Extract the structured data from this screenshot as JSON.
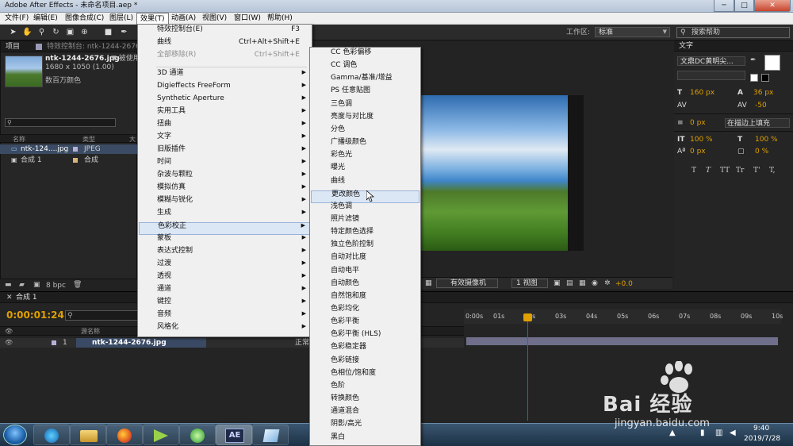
{
  "window": {
    "title": "Adobe After Effects - 未命名项目.aep *",
    "btn_min": "─",
    "btn_max": "□",
    "btn_close": "✕"
  },
  "menubar": [
    "文件(F)",
    "编辑(E)",
    "图像合成(C)",
    "图层(L)",
    "效果(T)",
    "动画(A)",
    "视图(V)",
    "窗口(W)",
    "帮助(H)"
  ],
  "toolbar": {
    "workspace_label": "工作区:",
    "workspace_value": "标准",
    "search_placeholder": "搜索帮助"
  },
  "project": {
    "tab": "项目",
    "effects_tab": "特效控制台: ntk-1244-2676",
    "file_name": "ntk-1244-2676.jpg",
    "file_suffix": "▼ 被使用",
    "file_dims": "1680 x 1050 (1.00)",
    "file_colors": "数百万颜色",
    "columns": [
      "名称",
      "类型",
      "大"
    ],
    "rows": [
      {
        "name": "ntk-124....jpg",
        "type": "JPEG"
      },
      {
        "name": "合成 1",
        "type": "合成"
      }
    ],
    "bpc": "8 bpc"
  },
  "viewer": {
    "views_label": "有效摄像机",
    "view_count": "1 视图",
    "exposure": "+0.0"
  },
  "character": {
    "tab": "文字",
    "font": "文鼎DC黄明尖...",
    "size": "160 px",
    "leading": "36 px",
    "tracking": "-50",
    "stroke": "0 px",
    "stroke_mode": "在描边上填充",
    "vscale": "100 %",
    "hscale": "100 %",
    "baseline": "0 px",
    "tsume": "0 %",
    "styles": [
      "T",
      "T",
      "TT",
      "Tr",
      "T'",
      "T,"
    ]
  },
  "timeline": {
    "tab": "合成 1",
    "timecode": "0:00:01:24",
    "col_source": "源名称",
    "layer_num": "1",
    "layer_name": "ntk-1244-2676.jpg",
    "layer_mode": "正常",
    "ruler": [
      "0:00s",
      "01s",
      "02s",
      "03s",
      "04s",
      "05s",
      "06s",
      "07s",
      "08s",
      "09s",
      "10s"
    ]
  },
  "effects_menu": {
    "items": [
      {
        "label": "特效控制台(E)",
        "shortcut": "F3"
      },
      {
        "label": "曲线",
        "shortcut": "Ctrl+Alt+Shift+E"
      },
      {
        "label": "全部移除(R)",
        "shortcut": "Ctrl+Shift+E",
        "disabled": true
      },
      {
        "label": "3D 通道",
        "sub": true
      },
      {
        "label": "Digieffects FreeForm",
        "sub": true
      },
      {
        "label": "Synthetic Aperture",
        "sub": true
      },
      {
        "label": "实用工具",
        "sub": true
      },
      {
        "label": "扭曲",
        "sub": true
      },
      {
        "label": "文字",
        "sub": true
      },
      {
        "label": "旧版插件",
        "sub": true
      },
      {
        "label": "时间",
        "sub": true
      },
      {
        "label": "杂波与颗粒",
        "sub": true
      },
      {
        "label": "模拟仿真",
        "sub": true
      },
      {
        "label": "模糊与锐化",
        "sub": true
      },
      {
        "label": "生成",
        "sub": true
      },
      {
        "label": "色彩校正",
        "sub": true,
        "highlight": true
      },
      {
        "label": "蒙板",
        "sub": true
      },
      {
        "label": "表达式控制",
        "sub": true
      },
      {
        "label": "过渡",
        "sub": true
      },
      {
        "label": "透视",
        "sub": true
      },
      {
        "label": "通道",
        "sub": true
      },
      {
        "label": "键控",
        "sub": true
      },
      {
        "label": "音频",
        "sub": true
      },
      {
        "label": "风格化",
        "sub": true
      }
    ]
  },
  "color_menu": {
    "items": [
      "CC 色彩偏移",
      "CC 调色",
      "Gamma/基准/增益",
      "PS 任意贴图",
      "三色调",
      "亮度与对比度",
      "分色",
      "广播级颜色",
      "彩色光",
      "曝光",
      "曲线",
      "更改颜色",
      "浅色调",
      "照片滤镜",
      "特定颜色选择",
      "独立色阶控制",
      "自动对比度",
      "自动电平",
      "自动颜色",
      "自然饱和度",
      "色彩均化",
      "色彩平衡",
      "色彩平衡 (HLS)",
      "色彩稳定器",
      "色彩链接",
      "色相位/饱和度",
      "色阶",
      "转换颜色",
      "通道混合",
      "阴影/高光",
      "黑白"
    ],
    "highlight": "更改颜色"
  },
  "taskbar": {
    "ae_label": "AE",
    "time": "9:40",
    "date": "2019/7/28"
  },
  "watermark": {
    "text": "Bai 经验",
    "url": "jingyan.baidu.com"
  },
  "colors": {
    "accent": "#dce7f5",
    "timecode": "#e0a000",
    "playhead": "#d42a2a"
  }
}
